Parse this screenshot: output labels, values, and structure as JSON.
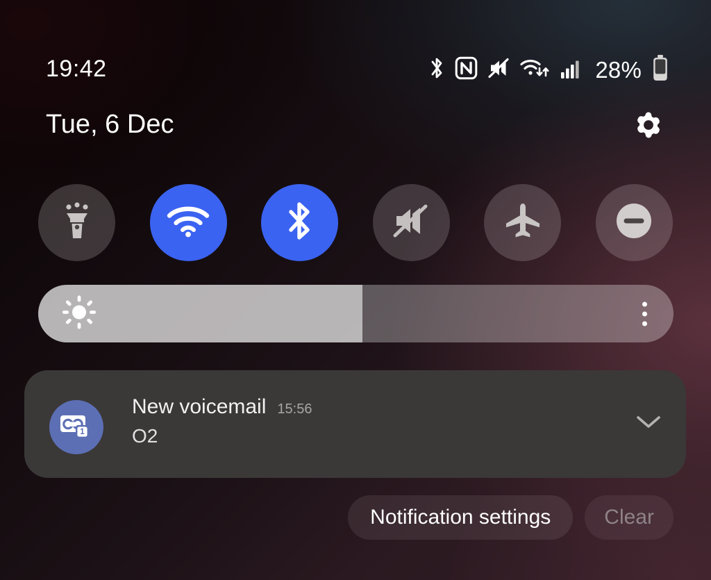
{
  "statusbar": {
    "time": "19:42",
    "battery_percent": "28%",
    "icons": [
      {
        "name": "bluetooth-icon",
        "label": "Bluetooth"
      },
      {
        "name": "nfc-icon",
        "label": "NFC"
      },
      {
        "name": "mute-icon",
        "label": "Sound off"
      },
      {
        "name": "wifi-data-icon",
        "label": "Wi-Fi"
      },
      {
        "name": "signal-bars-icon",
        "label": "Mobile signal"
      },
      {
        "name": "battery-icon",
        "label": "Battery"
      }
    ]
  },
  "header": {
    "date": "Tue, 6 Dec",
    "settings_label": "Settings"
  },
  "quick_settings": {
    "toggles": [
      {
        "id": "flashlight",
        "label": "Flashlight",
        "icon": "flashlight-icon",
        "state": "off"
      },
      {
        "id": "wifi",
        "label": "Wi-Fi",
        "icon": "wifi-icon",
        "state": "on"
      },
      {
        "id": "bluetooth",
        "label": "Bluetooth",
        "icon": "bluetooth-icon",
        "state": "on"
      },
      {
        "id": "sound",
        "label": "Mute",
        "icon": "mute-icon",
        "state": "off"
      },
      {
        "id": "airplane",
        "label": "Flight mode",
        "icon": "airplane-icon",
        "state": "off"
      },
      {
        "id": "dnd",
        "label": "Do not disturb",
        "icon": "do-not-disturb-icon",
        "state": "off"
      }
    ],
    "active_color": "#3b63f1",
    "inactive_color": "#585050"
  },
  "brightness": {
    "label": "Brightness",
    "value_percent": 51,
    "icon": "brightness-sun-icon",
    "menu_icon": "more-vertical-icon"
  },
  "notifications": [
    {
      "title": "New voicemail",
      "time": "15:56",
      "body": "O2",
      "icon": "voicemail-icon",
      "icon_badge": "1",
      "icon_color": "#5c6fb4",
      "expand_icon": "chevron-down-icon"
    }
  ],
  "footer": {
    "notification_settings_label": "Notification settings",
    "clear_label": "Clear"
  }
}
